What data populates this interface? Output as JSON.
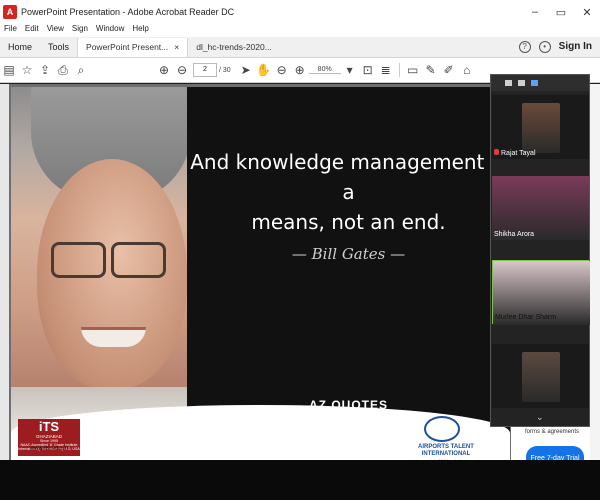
{
  "window": {
    "title": "PowerPoint Presentation - Adobe Acrobat Reader DC",
    "controls": [
      "–",
      "▭",
      "✕"
    ]
  },
  "menu": [
    "File",
    "Edit",
    "View",
    "Sign",
    "Window",
    "Help"
  ],
  "tabs": {
    "home": "Home",
    "tools": "Tools",
    "doc1": "PowerPoint Present...",
    "doc2": "dl_hc-trends-2020...",
    "close": "×",
    "sign_in": "Sign In"
  },
  "toolbar": {
    "page_current": "2",
    "page_total": "/ 30",
    "zoom": "80%"
  },
  "slide": {
    "quote_line1": "And knowledge management is a",
    "quote_line2": "means, not an end.",
    "author": "— Bill Gates —",
    "brand": "AZ QUOTES"
  },
  "its_logo": {
    "mark": "iTS",
    "city": "GHAZIABAD",
    "since": "Since 1995",
    "line1": "NAAC Accredited 'A' Grade Institute",
    "line2": "Internationally Accredited by IAO, USA",
    "url": "www.its.edu.in"
  },
  "airports_logo": {
    "line1": "AIRPORTS TALENT",
    "line2": "INTERNATIONAL",
    "tag": "we build future today"
  },
  "participants": [
    {
      "name": "Rajat Tayal",
      "color": "#6b4a3a"
    },
    {
      "name": "Shikha Arora",
      "color": "#7a3b5a"
    },
    {
      "name": "Murlee Dhar Sharm",
      "color": "#d9c6c9"
    },
    {
      "name": "",
      "color": "#5a4a40"
    }
  ],
  "promo": {
    "text": "forms & agreements",
    "button": "Free 7-day Trial"
  }
}
